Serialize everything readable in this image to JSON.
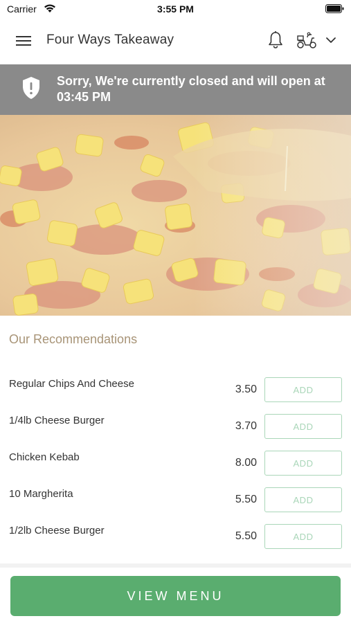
{
  "status_bar": {
    "carrier": "Carrier",
    "time": "3:55 PM"
  },
  "header": {
    "title": "Four Ways Takeaway",
    "icons": [
      "menu-icon",
      "bell-icon",
      "scooter-icon",
      "chevron-down-icon"
    ]
  },
  "banner": {
    "text": "Sorry, We're currently closed and will open at 03:45 PM",
    "icon": "shield-icon",
    "background": "#8a8a8a"
  },
  "hero": {
    "image": "hawaiian-pizza-photo"
  },
  "recommendations": {
    "title": "Our Recommendations",
    "items": [
      {
        "name": "Regular Chips And Cheese",
        "price": "3.50",
        "button": "ADD"
      },
      {
        "name": "1/4lb Cheese Burger",
        "price": "3.70",
        "button": "ADD"
      },
      {
        "name": "Chicken Kebab",
        "price": "8.00",
        "button": "ADD"
      },
      {
        "name": "10 Margherita",
        "price": "5.50",
        "button": "ADD"
      },
      {
        "name": "1/2lb Cheese Burger",
        "price": "5.50",
        "button": "ADD"
      }
    ]
  },
  "footer": {
    "view_menu_label": "VIEW MENU",
    "accent": "#5aad6f"
  }
}
